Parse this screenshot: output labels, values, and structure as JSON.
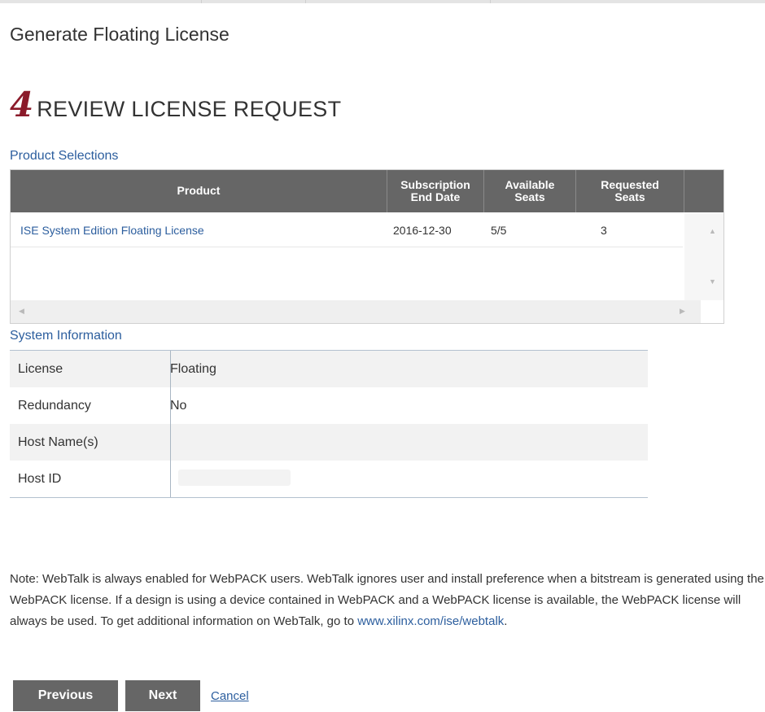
{
  "page": {
    "title": "Generate Floating License"
  },
  "step": {
    "number": "4",
    "title": "REVIEW LICENSE REQUEST"
  },
  "product_selections": {
    "label": "Product Selections",
    "columns": [
      "Product",
      "Subscription End Date",
      "Available Seats",
      "Requested Seats"
    ],
    "rows": [
      {
        "product": "ISE System Edition Floating License",
        "end_date": "2016-12-30",
        "available": "5/5",
        "requested": "3"
      }
    ]
  },
  "system_information": {
    "label": "System Information",
    "rows": [
      {
        "key": "License",
        "value": "Floating"
      },
      {
        "key": "Redundancy",
        "value": "No"
      },
      {
        "key": "Host Name(s)",
        "value": ""
      },
      {
        "key": "Host ID",
        "value": ""
      }
    ]
  },
  "note": {
    "text": "Note: WebTalk is always enabled for WebPACK users. WebTalk ignores user and install preference when a bitstream is generated using the WebPACK license. If a design is using a device contained in WebPACK and a WebPACK license is available, the WebPACK license will always be used. To get additional information on WebTalk, go to ",
    "link": "www.xilinx.com/ise/webtalk",
    "end": "."
  },
  "buttons": {
    "previous": "Previous",
    "next": "Next",
    "cancel": "Cancel"
  },
  "icons": {
    "scroll_up": "triangle-up",
    "scroll_down": "triangle-down",
    "scroll_left": "triangle-left",
    "scroll_right": "triangle-right"
  },
  "colors": {
    "header_bg": "#666666",
    "link": "#2c5e9e",
    "step_number": "#8b1a2a",
    "button_bg": "#666666"
  }
}
